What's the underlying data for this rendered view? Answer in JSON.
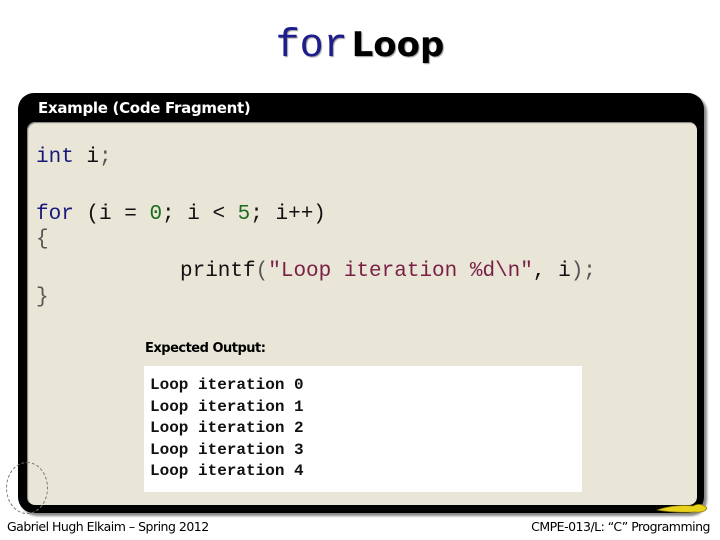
{
  "slide": {
    "title_keyword": "for",
    "title_word": "Loop"
  },
  "example": {
    "header": "Example (Code Fragment)",
    "code": {
      "line1": {
        "type": "int",
        "rest": " i",
        "semi": ";"
      },
      "line2": {
        "kw": "for",
        "open": " (i = ",
        "zero": "0",
        "mid": "; i < ",
        "five": "5",
        "end": "; i++)"
      },
      "line3": "{",
      "line4": {
        "fn": "printf",
        "paren": "(",
        "str": "\"Loop iteration %d\\n\"",
        "args": ", i",
        "close": ");"
      },
      "line5": "}"
    },
    "output_label": "Expected Output:",
    "output_lines": [
      "Loop iteration 0",
      "Loop iteration 1",
      "Loop iteration 2",
      "Loop iteration 3",
      "Loop iteration 4"
    ]
  },
  "footer": {
    "left": "Gabriel Hugh Elkaim – Spring 2012",
    "right": "CMPE-013/L: “C” Programming"
  },
  "colors": {
    "keyword": "#1a1a7a",
    "number": "#1c6b1c",
    "string": "#7a2046",
    "panel": "#e9e6d8",
    "frame": "#000000"
  }
}
